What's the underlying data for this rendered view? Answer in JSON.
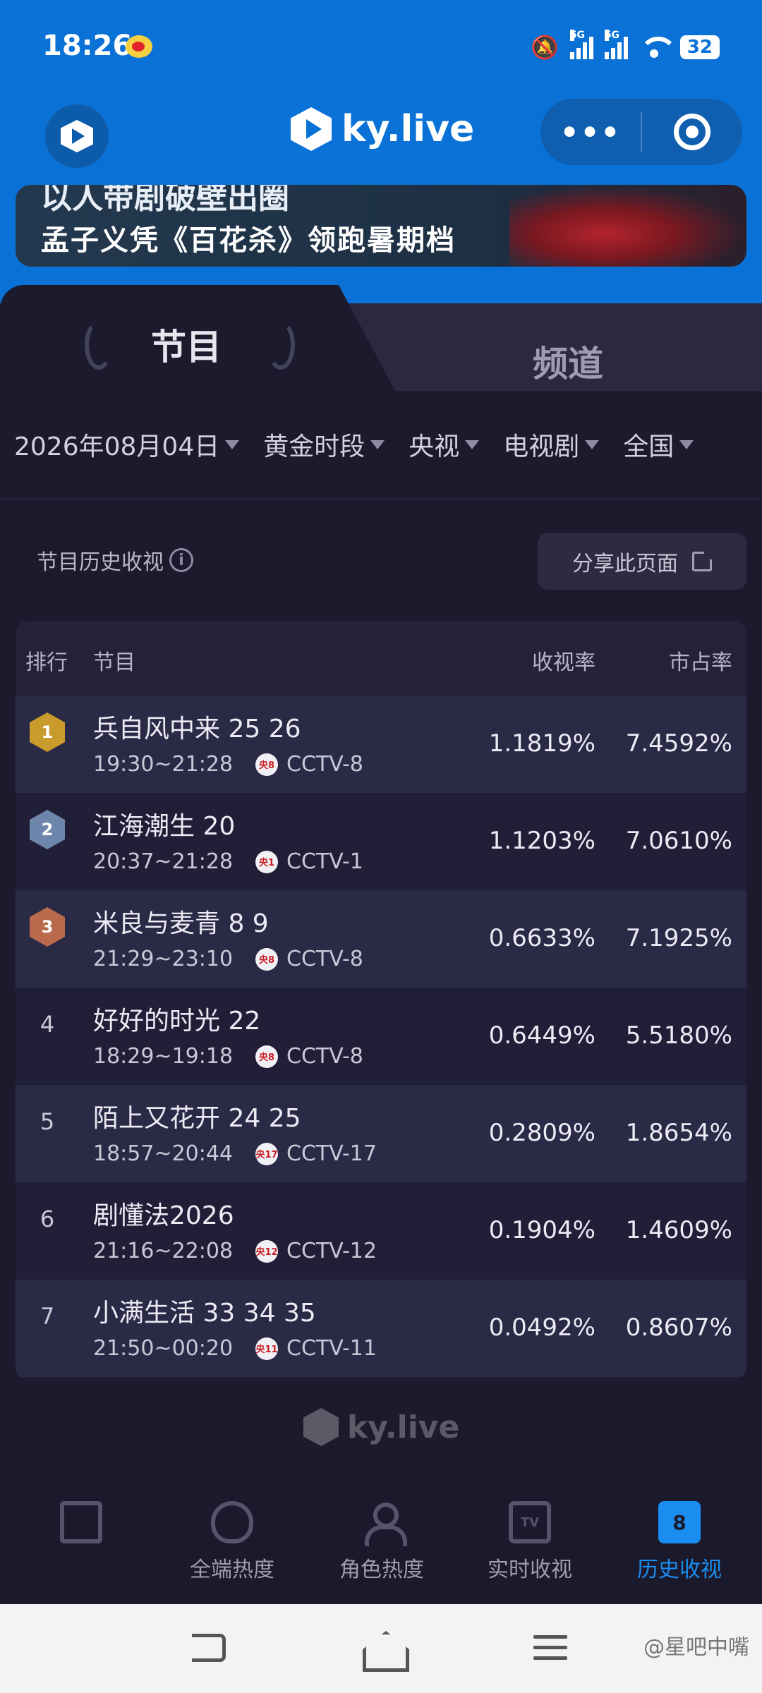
{
  "status_bar": {
    "time": "18:26",
    "network_1": "5G",
    "network_2": "5G",
    "battery": "32",
    "icons": [
      "weibo-icon",
      "bell-off-icon",
      "signal-icon",
      "signal-icon",
      "wifi-icon",
      "battery-icon"
    ]
  },
  "app": {
    "brand": "ky.live",
    "more_label": "•••"
  },
  "banner": {
    "line1": "以人带剧破壁出圈",
    "line2": "孟子义凭《百花杀》领跑暑期档"
  },
  "tabs": [
    {
      "label": "节目",
      "active": true
    },
    {
      "label": "频道",
      "active": false
    }
  ],
  "filters": [
    {
      "label": "2026年08月04日"
    },
    {
      "label": "黄金时段"
    },
    {
      "label": "央视"
    },
    {
      "label": "电视剧"
    },
    {
      "label": "全国"
    }
  ],
  "section": {
    "title": "节目历史收视",
    "info": "i",
    "share_label": "分享此页面"
  },
  "table": {
    "headers": {
      "rank": "排行",
      "program": "节目",
      "rating": "收视率",
      "share": "市占率"
    },
    "rows": [
      {
        "rank": "1",
        "title": "兵自风中来 25 26",
        "time": "19:30~21:28",
        "badge": "央8",
        "channel": "CCTV-8",
        "rating": "1.1819%",
        "share": "7.4592%"
      },
      {
        "rank": "2",
        "title": "江海潮生 20",
        "time": "20:37~21:28",
        "badge": "央1",
        "channel": "CCTV-1",
        "rating": "1.1203%",
        "share": "7.0610%"
      },
      {
        "rank": "3",
        "title": "米良与麦青 8 9",
        "time": "21:29~23:10",
        "badge": "央8",
        "channel": "CCTV-8",
        "rating": "0.6633%",
        "share": "7.1925%"
      },
      {
        "rank": "4",
        "title": "好好的时光 22",
        "time": "18:29~19:18",
        "badge": "央8",
        "channel": "CCTV-8",
        "rating": "0.6449%",
        "share": "5.5180%"
      },
      {
        "rank": "5",
        "title": "陌上又花开 24 25",
        "time": "18:57~20:44",
        "badge": "央17",
        "channel": "CCTV-17",
        "rating": "0.2809%",
        "share": "1.8654%"
      },
      {
        "rank": "6",
        "title": "剧懂法2026",
        "time": "21:16~22:08",
        "badge": "央12",
        "channel": "CCTV-12",
        "rating": "0.1904%",
        "share": "1.4609%"
      },
      {
        "rank": "7",
        "title": "小满生活 33 34 35",
        "time": "21:50~00:20",
        "badge": "央11",
        "channel": "CCTV-11",
        "rating": "0.0492%",
        "share": "0.8607%"
      }
    ]
  },
  "footer": {
    "brand": "ky.live"
  },
  "bottom_nav": [
    {
      "label": "",
      "icon": "book-icon"
    },
    {
      "label": "全端热度",
      "icon": "fire-icon"
    },
    {
      "label": "角色热度",
      "icon": "user-icon"
    },
    {
      "label": "实时收视",
      "icon": "tv-icon",
      "icon_text": "TV"
    },
    {
      "label": "历史收视",
      "icon": "history-icon",
      "icon_text": "8",
      "active": true
    }
  ],
  "watermark": "@星吧中嘴"
}
